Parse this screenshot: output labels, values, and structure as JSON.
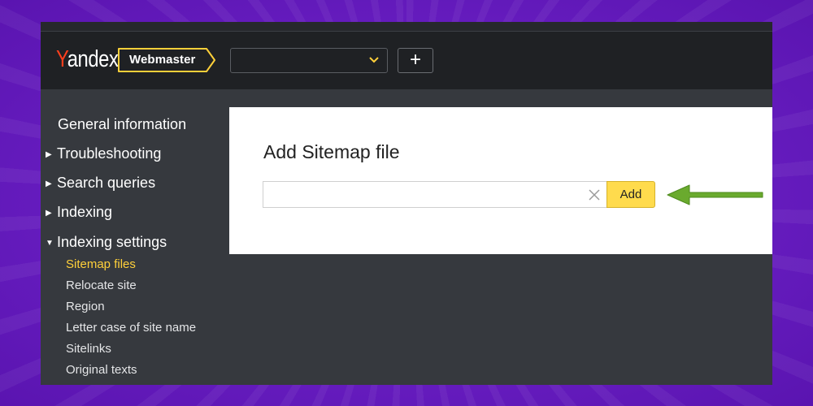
{
  "header": {
    "logo_text": "Yandex",
    "logo_first_letter": "Y",
    "logo_rest": "andex",
    "service_label": "Webmaster",
    "site_selector_value": "",
    "add_site_label": "+"
  },
  "sidebar": {
    "items": [
      {
        "label": "General information",
        "expandable": false
      },
      {
        "label": "Troubleshooting",
        "expandable": true,
        "expanded": false
      },
      {
        "label": "Search queries",
        "expandable": true,
        "expanded": false
      },
      {
        "label": "Indexing",
        "expandable": true,
        "expanded": false
      },
      {
        "label": "Indexing settings",
        "expandable": true,
        "expanded": true
      }
    ],
    "subitems": [
      {
        "label": "Sitemap files",
        "active": true
      },
      {
        "label": "Relocate site",
        "active": false
      },
      {
        "label": "Region",
        "active": false
      },
      {
        "label": "Letter case of site name",
        "active": false
      },
      {
        "label": "Sitelinks",
        "active": false
      },
      {
        "label": "Original texts",
        "active": false
      }
    ]
  },
  "main": {
    "title": "Add Sitemap file",
    "url_input_value": "",
    "add_button_label": "Add"
  },
  "colors": {
    "brand_yellow": "#ffdb4d",
    "active_link": "#ffd03a",
    "logo_red": "#fc3f1d",
    "arrow_green": "#6aaa2e",
    "header_bg": "#1f2124",
    "panel_bg": "#36393e"
  },
  "icons": {
    "dropdown": "chevron-down-icon",
    "clear": "close-icon",
    "expand": "triangle-right-icon",
    "expanded": "triangle-down-icon",
    "pointer": "arrow-left-icon"
  }
}
